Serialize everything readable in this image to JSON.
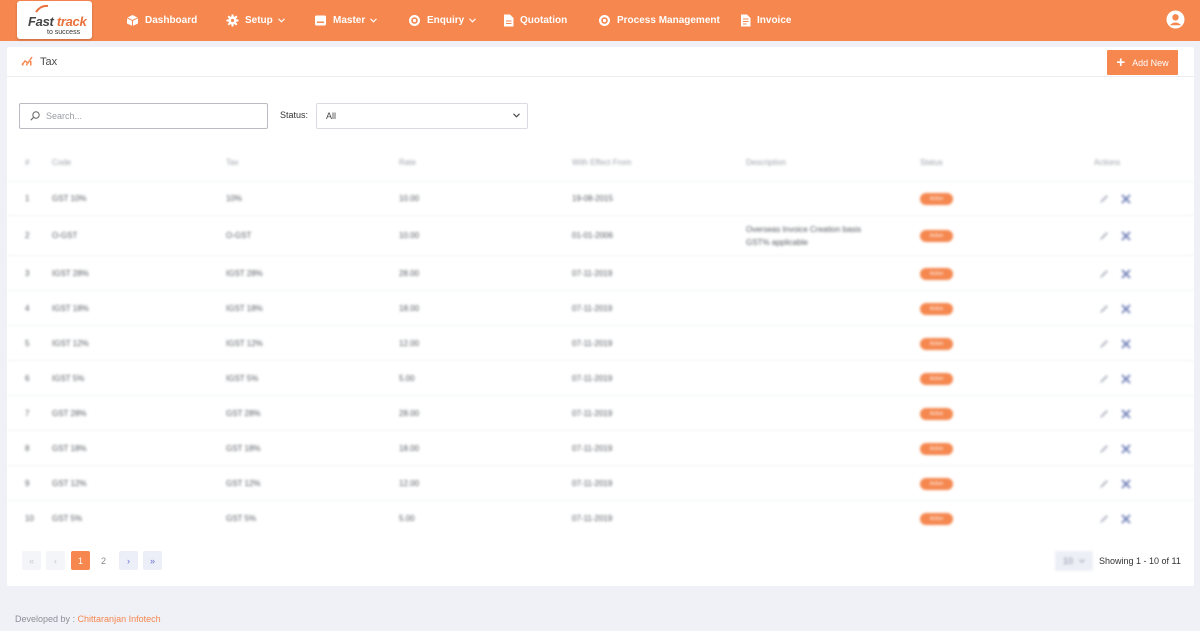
{
  "brand": {
    "logo_main": "Fast",
    "logo_accent": "track",
    "logo_sub": "to success"
  },
  "nav": [
    {
      "label": "Dashboard",
      "icon": "cube-icon"
    },
    {
      "label": "Setup",
      "icon": "gear-icon",
      "dropdown": true
    },
    {
      "label": "Master",
      "icon": "card-icon",
      "dropdown": true
    },
    {
      "label": "Enquiry",
      "icon": "target-icon",
      "dropdown": true
    },
    {
      "label": "Quotation",
      "icon": "file-icon"
    },
    {
      "label": "Process Management",
      "icon": "target-icon"
    },
    {
      "label": "Invoice",
      "icon": "invoice-icon"
    }
  ],
  "page": {
    "title": "Tax",
    "add_label": "Add New"
  },
  "filters": {
    "search_placeholder": "Search...",
    "status_label": "Status:",
    "status_value": "All"
  },
  "table": {
    "columns": [
      "#",
      "Code",
      "Tax",
      "Rate",
      "With Effect From",
      "Description",
      "Status",
      "Actions"
    ],
    "rows": [
      {
        "n": "1",
        "code": "GST 10%",
        "tax": "10%",
        "rate": "10.00",
        "from": "19-08-2015",
        "desc": "",
        "status": "Active"
      },
      {
        "n": "2",
        "code": "O-GST",
        "tax": "O-GST",
        "rate": "10.00",
        "from": "01-01-2006",
        "desc": "Overseas Invoice Creation basis GST% applicable",
        "status": "Active"
      },
      {
        "n": "3",
        "code": "IGST 28%",
        "tax": "IGST 28%",
        "rate": "28.00",
        "from": "07-11-2019",
        "desc": "",
        "status": "Active"
      },
      {
        "n": "4",
        "code": "IGST 18%",
        "tax": "IGST 18%",
        "rate": "18.00",
        "from": "07-11-2019",
        "desc": "",
        "status": "Active"
      },
      {
        "n": "5",
        "code": "IGST 12%",
        "tax": "IGST 12%",
        "rate": "12.00",
        "from": "07-11-2019",
        "desc": "",
        "status": "Active"
      },
      {
        "n": "6",
        "code": "IGST 5%",
        "tax": "IGST 5%",
        "rate": "5.00",
        "from": "07-11-2019",
        "desc": "",
        "status": "Active"
      },
      {
        "n": "7",
        "code": "GST 28%",
        "tax": "GST 28%",
        "rate": "28.00",
        "from": "07-11-2019",
        "desc": "",
        "status": "Active"
      },
      {
        "n": "8",
        "code": "GST 18%",
        "tax": "GST 18%",
        "rate": "18.00",
        "from": "07-11-2019",
        "desc": "",
        "status": "Active"
      },
      {
        "n": "9",
        "code": "GST 12%",
        "tax": "GST 12%",
        "rate": "12.00",
        "from": "07-11-2019",
        "desc": "",
        "status": "Active"
      },
      {
        "n": "10",
        "code": "GST 5%",
        "tax": "GST 5%",
        "rate": "5.00",
        "from": "07-11-2019",
        "desc": "",
        "status": "Active"
      }
    ]
  },
  "pagination": {
    "first": "«",
    "prev": "‹",
    "pages": [
      "1",
      "2"
    ],
    "current": "1",
    "next": "›",
    "last": "»",
    "per_page": "10",
    "showing": "Showing 1 - 10 of 11"
  },
  "footer": {
    "prefix": "Developed by : ",
    "company": "Chittaranjan Infotech"
  },
  "colors": {
    "accent": "#f5874f",
    "background": "#f0f1f6"
  }
}
